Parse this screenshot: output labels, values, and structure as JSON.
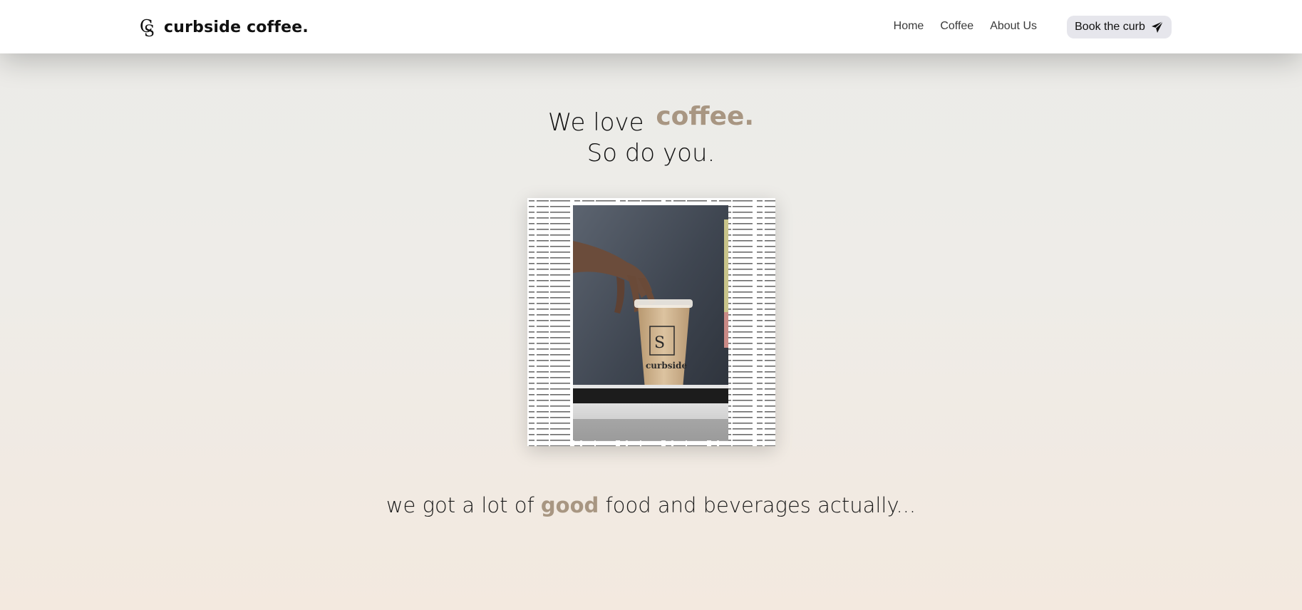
{
  "brand": {
    "name": "curbside coffee."
  },
  "nav": {
    "links": [
      {
        "label": "Home"
      },
      {
        "label": "Coffee"
      },
      {
        "label": "About Us"
      }
    ],
    "cta_label": "Book the curb"
  },
  "hero": {
    "line1_prefix": "We love",
    "line1_accent": "coffee.",
    "line2": "So do you.",
    "cup_text": "curbside"
  },
  "tagline": {
    "prefix": "we got a lot of",
    "accent": "good",
    "suffix": "food and beverages actually..."
  },
  "colors": {
    "accent": "#a89682",
    "nav_bg": "#ffffff",
    "button_bg": "#e6e6ec",
    "text": "#111111"
  }
}
